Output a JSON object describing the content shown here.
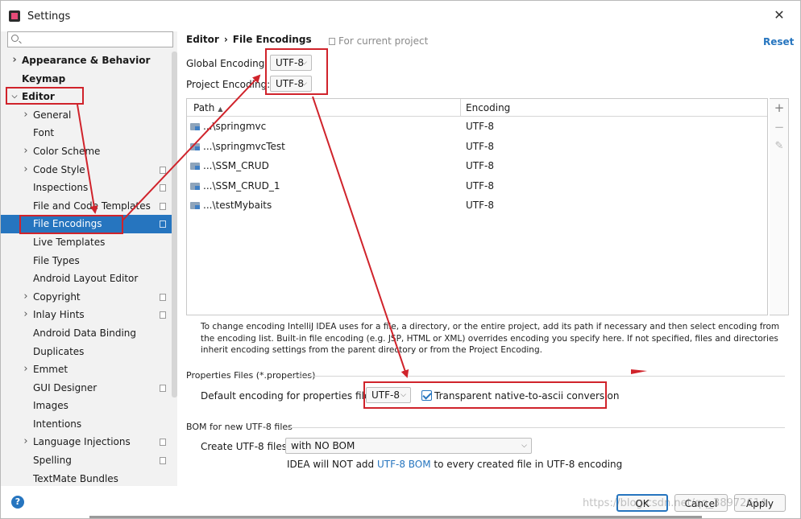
{
  "window": {
    "title": "Settings",
    "close_glyph": "✕"
  },
  "search": {
    "placeholder": "",
    "value": "",
    "icon": "search-icon"
  },
  "tree": [
    {
      "label": "Appearance & Behavior",
      "bold": true,
      "level": 0,
      "chevron": "right"
    },
    {
      "label": "Keymap",
      "bold": true,
      "level": 0,
      "chevron": ""
    },
    {
      "label": "Editor",
      "bold": true,
      "level": 0,
      "chevron": "down"
    },
    {
      "label": "General",
      "bold": false,
      "level": 1,
      "chevron": "right"
    },
    {
      "label": "Font",
      "bold": false,
      "level": 1,
      "chevron": ""
    },
    {
      "label": "Color Scheme",
      "bold": false,
      "level": 1,
      "chevron": "right"
    },
    {
      "label": "Code Style",
      "bold": false,
      "level": 1,
      "chevron": "right",
      "project_icon": true
    },
    {
      "label": "Inspections",
      "bold": false,
      "level": 1,
      "chevron": "",
      "project_icon": true
    },
    {
      "label": "File and Code Templates",
      "bold": false,
      "level": 1,
      "chevron": "",
      "project_icon": true
    },
    {
      "label": "File Encodings",
      "bold": false,
      "level": 1,
      "chevron": "",
      "selected": true,
      "project_icon": true
    },
    {
      "label": "Live Templates",
      "bold": false,
      "level": 1,
      "chevron": ""
    },
    {
      "label": "File Types",
      "bold": false,
      "level": 1,
      "chevron": ""
    },
    {
      "label": "Android Layout Editor",
      "bold": false,
      "level": 1,
      "chevron": ""
    },
    {
      "label": "Copyright",
      "bold": false,
      "level": 1,
      "chevron": "right",
      "project_icon": true
    },
    {
      "label": "Inlay Hints",
      "bold": false,
      "level": 1,
      "chevron": "right",
      "project_icon": true
    },
    {
      "label": "Android Data Binding",
      "bold": false,
      "level": 1,
      "chevron": ""
    },
    {
      "label": "Duplicates",
      "bold": false,
      "level": 1,
      "chevron": ""
    },
    {
      "label": "Emmet",
      "bold": false,
      "level": 1,
      "chevron": "right"
    },
    {
      "label": "GUI Designer",
      "bold": false,
      "level": 1,
      "chevron": "",
      "project_icon": true
    },
    {
      "label": "Images",
      "bold": false,
      "level": 1,
      "chevron": ""
    },
    {
      "label": "Intentions",
      "bold": false,
      "level": 1,
      "chevron": ""
    },
    {
      "label": "Language Injections",
      "bold": false,
      "level": 1,
      "chevron": "right",
      "project_icon": true
    },
    {
      "label": "Spelling",
      "bold": false,
      "level": 1,
      "chevron": "",
      "project_icon": true
    },
    {
      "label": "TextMate Bundles",
      "bold": false,
      "level": 1,
      "chevron": ""
    }
  ],
  "header": {
    "breadcrumb_parent": "Editor",
    "breadcrumb_sep": "›",
    "breadcrumb_current": "File Encodings",
    "for_project": "For current project",
    "reset": "Reset"
  },
  "encodings": {
    "global_label": "Global Encoding:",
    "global_value": "UTF-8",
    "project_label": "Project Encoding:",
    "project_value": "UTF-8"
  },
  "table": {
    "columns": [
      "Path",
      "Encoding"
    ],
    "sort_glyph": "▲",
    "rows": [
      {
        "path": "...\\springmvc",
        "encoding": "UTF-8"
      },
      {
        "path": "...\\springmvcTest",
        "encoding": "UTF-8"
      },
      {
        "path": "...\\SSM_CRUD",
        "encoding": "UTF-8"
      },
      {
        "path": "...\\SSM_CRUD_1",
        "encoding": "UTF-8"
      },
      {
        "path": "...\\testMybaits",
        "encoding": "UTF-8"
      }
    ],
    "tools": {
      "add": "+",
      "remove": "−",
      "edit": "✎"
    }
  },
  "description": "To change encoding IntelliJ IDEA uses for a file, a directory, or the entire project, add its path if necessary and then select encoding from the encoding list. Built-in file encoding (e.g. JSP, HTML or XML) overrides encoding you specify here. If not specified, files and directories inherit encoding settings from the parent directory or from the Project Encoding.",
  "properties": {
    "section": "Properties Files (*.properties)",
    "default_label": "Default encoding for properties files:",
    "default_value": "UTF-8",
    "transparent_label": "Transparent native-to-ascii conversion",
    "transparent_checked": true
  },
  "bom": {
    "section": "BOM for new UTF-8 files",
    "create_label": "Create UTF-8 files:",
    "create_value": "with NO BOM",
    "note_prefix": "IDEA will NOT add ",
    "note_link": "UTF-8 BOM",
    "note_suffix": " to every created file in UTF-8 encoding"
  },
  "footer": {
    "help": "?",
    "ok": "OK",
    "cancel": "Cancel",
    "apply": "Apply",
    "watermark": "https://blog.csdn.net/qq_38972614"
  },
  "colors": {
    "accent": "#2675bf",
    "selection": "#2675bf",
    "annotation": "#d0232b",
    "sidebar_bg": "#f2f2f2"
  }
}
